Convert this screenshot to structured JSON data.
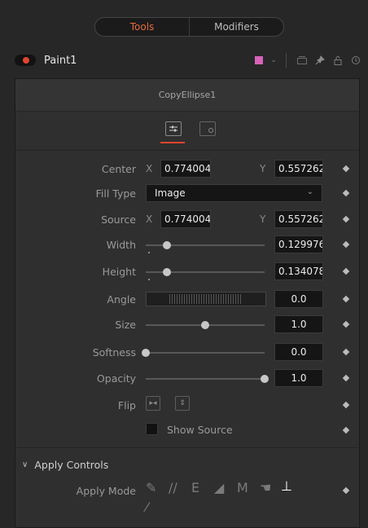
{
  "tabs": {
    "tools": "Tools",
    "modifiers": "Modifiers"
  },
  "header": {
    "node_name": "Paint1",
    "swatch_color": "#d763b9",
    "icons": [
      "color-swatch-icon",
      "chevron-down-icon",
      "view-icon",
      "pin-icon",
      "lock-icon",
      "reset-icon"
    ]
  },
  "panel": {
    "title": "CopyEllipse1",
    "tabs_icons": [
      "controls-icon",
      "settings-icon"
    ],
    "accent_color": "#e2452f"
  },
  "controls": {
    "center": {
      "label": "Center",
      "x_axis": "X",
      "x_value": "0.774004",
      "y_axis": "Y",
      "y_value": "0.557262"
    },
    "fill_type": {
      "label": "Fill Type",
      "value": "Image"
    },
    "source": {
      "label": "Source",
      "x_axis": "X",
      "x_value": "0.774004",
      "y_axis": "Y",
      "y_value": "0.557262"
    },
    "width": {
      "label": "Width",
      "value": "0.129976",
      "level": 0.18
    },
    "height": {
      "label": "Height",
      "value": "0.134078",
      "level": 0.18
    },
    "angle": {
      "label": "Angle",
      "value": "0.0"
    },
    "size": {
      "label": "Size",
      "value": "1.0",
      "level": 0.5
    },
    "softness": {
      "label": "Softness",
      "value": "0.0",
      "level": 0.0
    },
    "opacity": {
      "label": "Opacity",
      "value": "1.0",
      "level": 1.0
    },
    "flip": {
      "label": "Flip",
      "icons": [
        "flip-horizontal-icon",
        "flip-vertical-icon"
      ]
    },
    "show_source": {
      "label": "Show Source",
      "checked": false
    }
  },
  "apply_controls": {
    "section_label": "Apply Controls",
    "apply_mode_label": "Apply Mode",
    "mode_icons": [
      "color-brush-icon",
      "clone-icon",
      "emboss-icon",
      "eraser-icon",
      "merge-icon",
      "smear-icon",
      "stamp-icon",
      "wire-icon"
    ],
    "active_mode": "stamp-icon"
  }
}
